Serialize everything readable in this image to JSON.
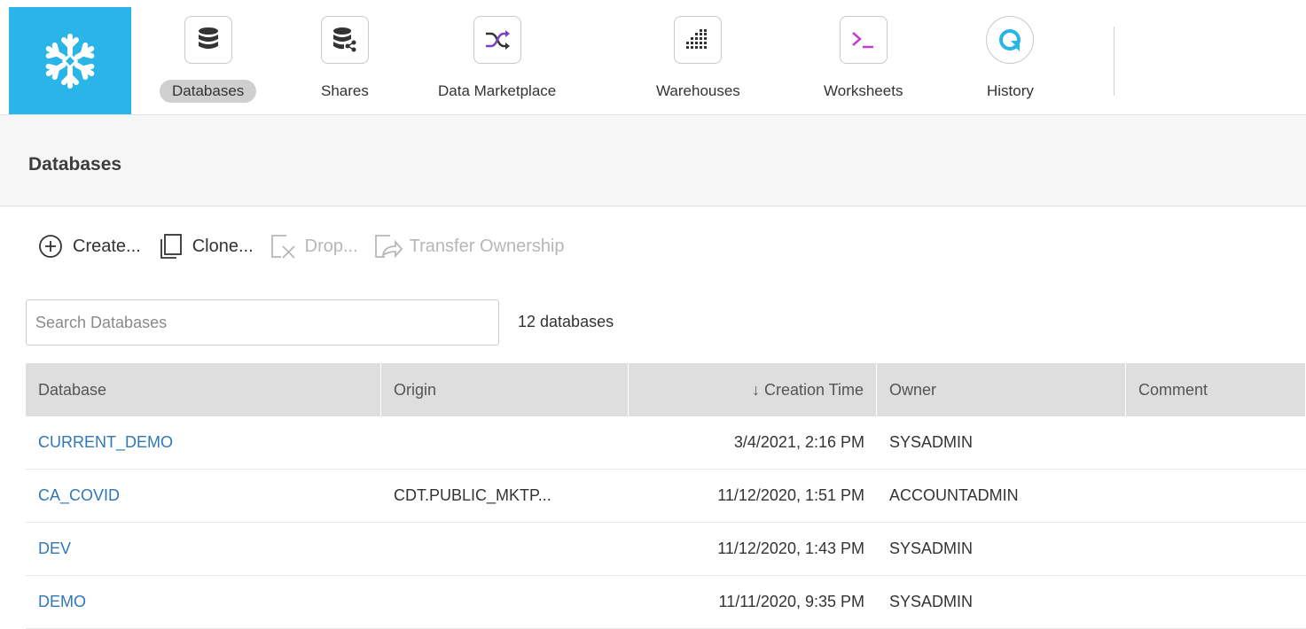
{
  "nav": {
    "items": [
      {
        "label": "Databases",
        "icon": "database-icon",
        "active": true
      },
      {
        "label": "Shares",
        "icon": "share-icon"
      },
      {
        "label": "Data Marketplace",
        "icon": "shuffle-icon"
      },
      {
        "label": "Warehouses",
        "icon": "warehouse-icon"
      },
      {
        "label": "Worksheets",
        "icon": "terminal-icon"
      },
      {
        "label": "History",
        "icon": "history-icon"
      }
    ],
    "brand_color": "#29b5e8"
  },
  "page": {
    "title": "Databases"
  },
  "toolbar": {
    "create": "Create...",
    "clone": "Clone...",
    "drop": "Drop...",
    "transfer": "Transfer Ownership"
  },
  "search": {
    "placeholder": "Search Databases",
    "value": ""
  },
  "summary": {
    "count": "12 databases"
  },
  "table": {
    "columns": [
      "Database",
      "Origin",
      "↓ Creation Time",
      "Owner",
      "Comment"
    ],
    "rows": [
      {
        "database": "CURRENT_DEMO",
        "origin": "",
        "created": "3/4/2021, 2:16 PM",
        "owner": "SYSADMIN",
        "comment": ""
      },
      {
        "database": "CA_COVID",
        "origin": "CDT.PUBLIC_MKTP...",
        "created": "11/12/2020, 1:51 PM",
        "owner": "ACCOUNTADMIN",
        "comment": ""
      },
      {
        "database": "DEV",
        "origin": "",
        "created": "11/12/2020, 1:43 PM",
        "owner": "SYSADMIN",
        "comment": ""
      },
      {
        "database": "DEMO",
        "origin": "",
        "created": "11/11/2020, 9:35 PM",
        "owner": "SYSADMIN",
        "comment": ""
      }
    ]
  },
  "colors": {
    "link": "#2f77b9",
    "disabled": "#b7b7b7",
    "header_bg": "#dedede"
  }
}
